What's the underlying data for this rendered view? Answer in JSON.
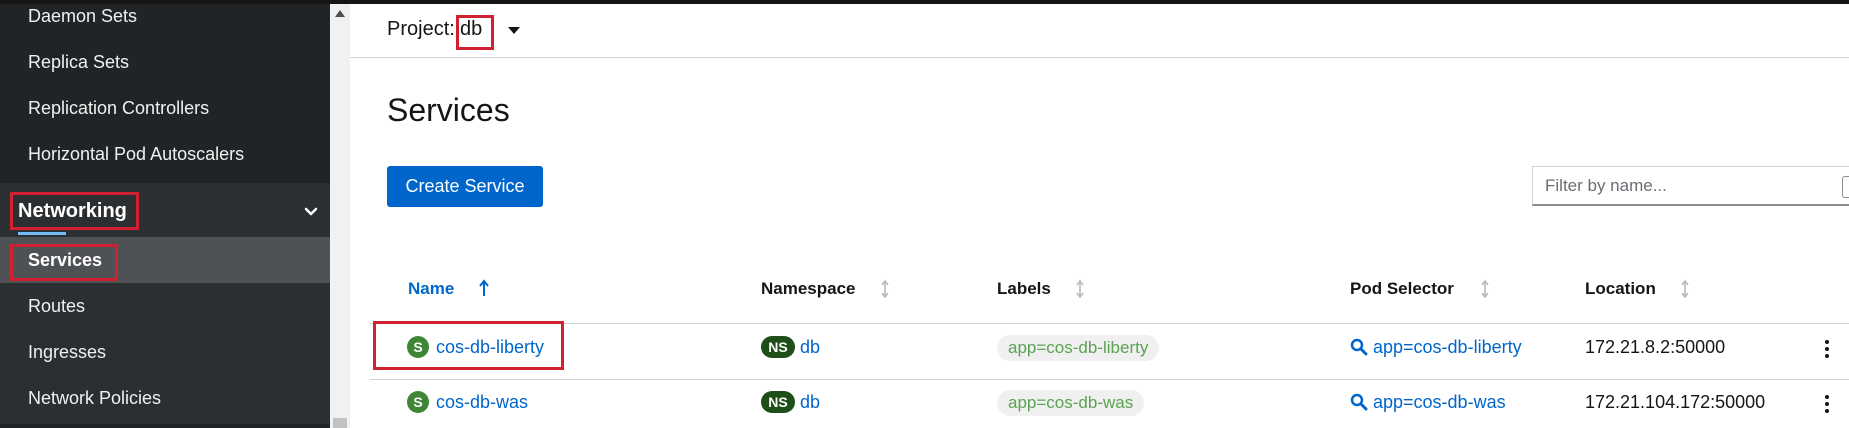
{
  "sidebar": {
    "items": [
      {
        "label": "Daemon Sets"
      },
      {
        "label": "Replica Sets"
      },
      {
        "label": "Replication Controllers"
      },
      {
        "label": "Horizontal Pod Autoscalers"
      }
    ],
    "section": {
      "label": "Networking",
      "expanded": true
    },
    "sub_items": [
      {
        "label": "Services",
        "active": true
      },
      {
        "label": "Routes"
      },
      {
        "label": "Ingresses"
      },
      {
        "label": "Network Policies"
      }
    ]
  },
  "header": {
    "project_label": "Project:",
    "project_value": "db"
  },
  "page": {
    "title": "Services",
    "create_button": "Create Service",
    "filter_placeholder": "Filter by name..."
  },
  "table": {
    "columns": [
      "Name",
      "Namespace",
      "Labels",
      "Pod Selector",
      "Location"
    ],
    "sorted_column": "Name",
    "rows": [
      {
        "badge": "S",
        "name": "cos-db-liberty",
        "ns_badge": "NS",
        "namespace": "db",
        "labels": "app=cos-db-liberty",
        "selector": "app=cos-db-liberty",
        "location": "172.21.8.2:50000"
      },
      {
        "badge": "S",
        "name": "cos-db-was",
        "ns_badge": "NS",
        "namespace": "db",
        "labels": "app=cos-db-was",
        "selector": "app=cos-db-was",
        "location": "172.21.104.172:50000"
      }
    ]
  },
  "colors": {
    "sidebar_bg": "#212427",
    "accent_blue": "#0066cc",
    "highlight_red": "#d1202f",
    "service_badge": "#3e8635",
    "namespace_badge": "#1e4f18",
    "label_text": "#5ba352"
  },
  "icons": [
    "chevron-down-icon",
    "caret-down-icon",
    "sort-up-icon",
    "sort-icon",
    "search-icon",
    "kebab-icon"
  ]
}
